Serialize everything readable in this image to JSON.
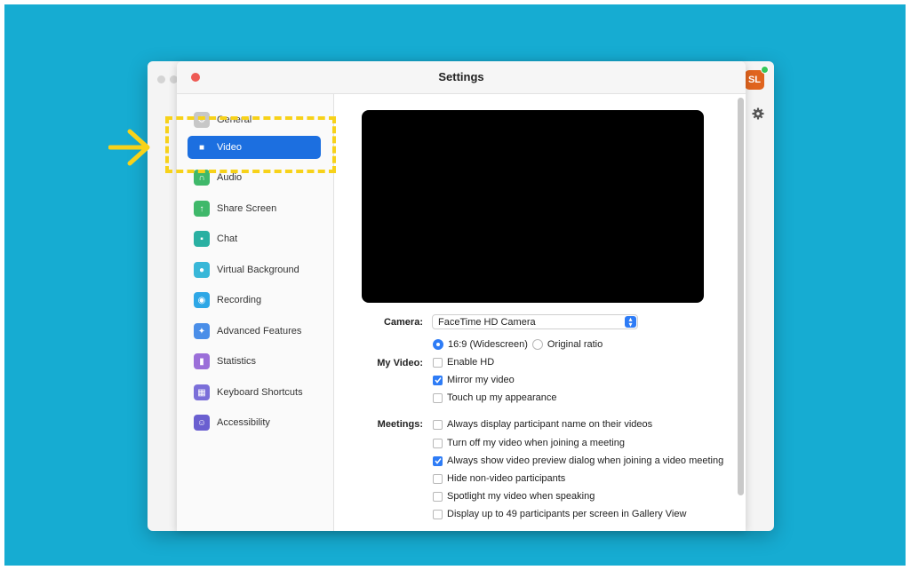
{
  "window": {
    "title": "Settings"
  },
  "user": {
    "initials": "SL"
  },
  "colors": {
    "background": "#16acd2",
    "accent": "#1c6fe0",
    "checkbox": "#2e7cf6",
    "annotation": "#f7d21a"
  },
  "sidebar": {
    "items": [
      {
        "label": "General",
        "icon": "gear-icon",
        "color": "#c7c7c7"
      },
      {
        "label": "Video",
        "icon": "video-camera-icon",
        "color": "#1c6fe0",
        "active": true
      },
      {
        "label": "Audio",
        "icon": "headphones-icon",
        "color": "#3fb86a"
      },
      {
        "label": "Share Screen",
        "icon": "share-screen-icon",
        "color": "#3fb86a"
      },
      {
        "label": "Chat",
        "icon": "chat-bubble-icon",
        "color": "#2ab0a2"
      },
      {
        "label": "Virtual Background",
        "icon": "person-background-icon",
        "color": "#38b7d8"
      },
      {
        "label": "Recording",
        "icon": "record-icon",
        "color": "#2ea7e6"
      },
      {
        "label": "Advanced Features",
        "icon": "sparkle-icon",
        "color": "#4a8ee8"
      },
      {
        "label": "Statistics",
        "icon": "bar-chart-icon",
        "color": "#9b6fd9"
      },
      {
        "label": "Keyboard Shortcuts",
        "icon": "keyboard-icon",
        "color": "#7b6fd9"
      },
      {
        "label": "Accessibility",
        "icon": "accessibility-icon",
        "color": "#6a5fd0"
      }
    ]
  },
  "video": {
    "camera_label": "Camera:",
    "camera_value": "FaceTime HD Camera",
    "my_video_label": "My Video:",
    "ratio_widescreen": "16:9 (Widescreen)",
    "ratio_original": "Original ratio",
    "options": [
      {
        "label": "Enable HD",
        "checked": false
      },
      {
        "label": "Mirror my video",
        "checked": true
      },
      {
        "label": "Touch up my appearance",
        "checked": false
      }
    ],
    "meetings_label": "Meetings:",
    "meeting_options": [
      {
        "label": "Always display participant name on their videos",
        "checked": false
      },
      {
        "label": "Turn off my video when joining a meeting",
        "checked": false
      },
      {
        "label": "Always show video preview dialog when joining a video meeting",
        "checked": true
      },
      {
        "label": "Hide non-video participants",
        "checked": false
      },
      {
        "label": "Spotlight my video when speaking",
        "checked": false
      },
      {
        "label": "Display up to 49 participants per screen in Gallery View",
        "checked": false
      }
    ]
  }
}
